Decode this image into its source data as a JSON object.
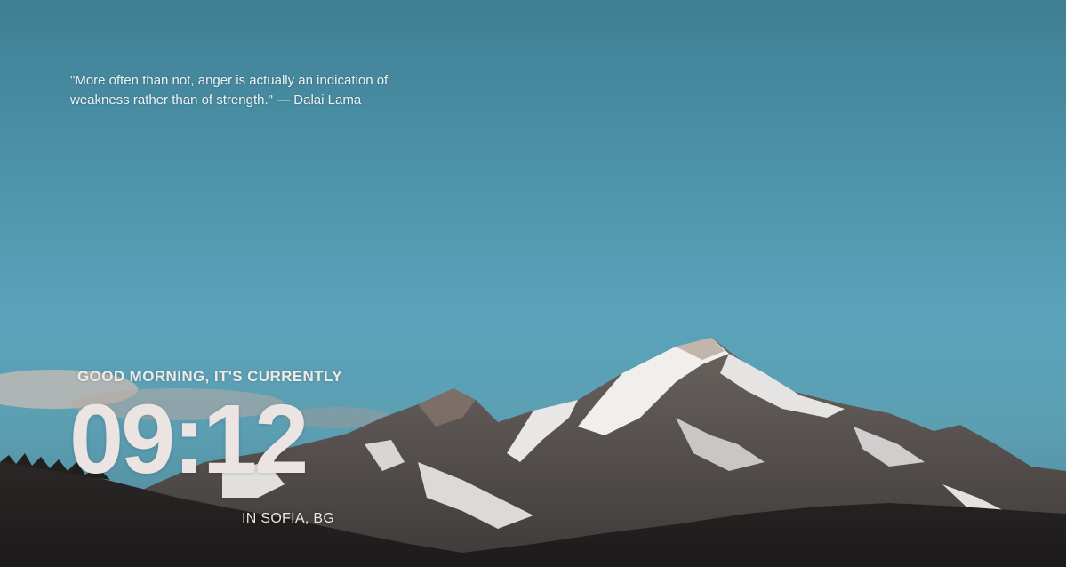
{
  "quote": {
    "text": "\"More often than not, anger is actually an indication of weakness rather than of strength.\"",
    "author": "— Dalai Lama"
  },
  "clock": {
    "greeting": "GOOD MORNING, IT'S CURRENTLY",
    "time": "09:12",
    "location": "IN SOFIA, BG"
  }
}
